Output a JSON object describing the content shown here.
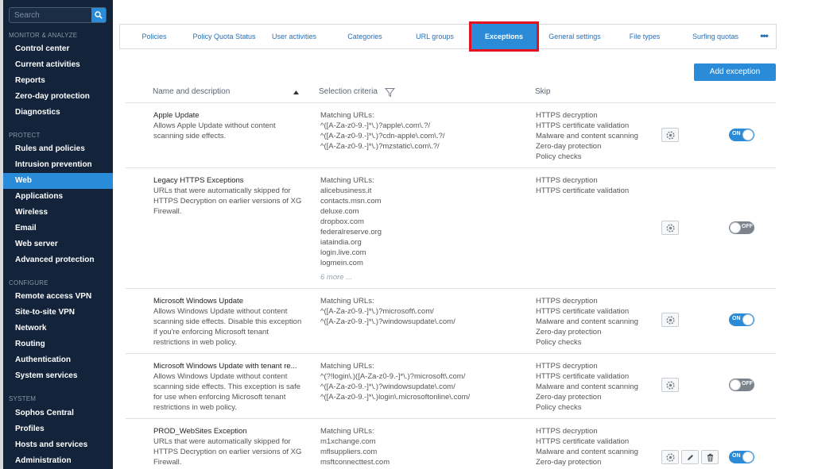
{
  "sidebar": {
    "search_placeholder": "Search",
    "sections": [
      {
        "label": "MONITOR & ANALYZE",
        "items": [
          "Control center",
          "Current activities",
          "Reports",
          "Zero-day protection",
          "Diagnostics"
        ]
      },
      {
        "label": "PROTECT",
        "items": [
          "Rules and policies",
          "Intrusion prevention",
          "Web",
          "Applications",
          "Wireless",
          "Email",
          "Web server",
          "Advanced protection"
        ]
      },
      {
        "label": "CONFIGURE",
        "items": [
          "Remote access VPN",
          "Site-to-site VPN",
          "Network",
          "Routing",
          "Authentication",
          "System services"
        ]
      },
      {
        "label": "SYSTEM",
        "items": [
          "Sophos Central",
          "Profiles",
          "Hosts and services",
          "Administration"
        ]
      }
    ],
    "active_item": "Web"
  },
  "tabs": [
    "Policies",
    "Policy Quota Status",
    "User activities",
    "Categories",
    "URL groups",
    "Exceptions",
    "General settings",
    "File types",
    "Surfing quotas"
  ],
  "active_tab": "Exceptions",
  "more_tabs": "•••",
  "add_button": "Add exception",
  "table": {
    "headers": {
      "name": "Name and description",
      "criteria": "Selection criteria",
      "skip": "Skip"
    },
    "rows": [
      {
        "name": "Apple Update",
        "description": "Allows Apple Update without content scanning side effects.",
        "criteria_label": "Matching URLs:",
        "criteria": [
          "^([A-Za-z0-9.-]*\\.)?apple\\.com\\.?/",
          "^([A-Za-z0-9.-]*\\.)?cdn-apple\\.com\\.?/",
          "^([A-Za-z0-9.-]*\\.)?mzstatic\\.com\\.?/"
        ],
        "more": "",
        "skip": [
          "HTTPS decryption",
          "HTTPS certificate validation",
          "Malware and content scanning",
          "Zero-day protection",
          "Policy checks"
        ],
        "enabled": "ON"
      },
      {
        "name": "Legacy HTTPS Exceptions",
        "description": "URLs that were automatically skipped for HTTPS Decryption on earlier versions of XG Firewall.",
        "criteria_label": "Matching URLs:",
        "criteria": [
          "alicebusiness.it",
          "contacts.msn.com",
          "deluxe.com",
          "dropbox.com",
          "federalreserve.org",
          "iataindia.org",
          "login.live.com",
          "logmein.com"
        ],
        "more": "6 more ...",
        "skip": [
          "HTTPS decryption",
          "HTTPS certificate validation"
        ],
        "enabled": "OFF"
      },
      {
        "name": "Microsoft Windows Update",
        "description": "Allows Windows Update without content scanning side effects. Disable this exception if you're enforcing Microsoft tenant restrictions in web policy.",
        "criteria_label": "Matching URLs:",
        "criteria": [
          "^([A-Za-z0-9.-]*\\.)?microsoft\\.com/",
          "^([A-Za-z0-9.-]*\\.)?windowsupdate\\.com/"
        ],
        "more": "",
        "skip": [
          "HTTPS decryption",
          "HTTPS certificate validation",
          "Malware and content scanning",
          "Zero-day protection",
          "Policy checks"
        ],
        "enabled": "ON"
      },
      {
        "name": "Microsoft Windows Update with tenant re...",
        "description": "Allows Windows Update without content scanning side effects. This exception is safe for use when enforcing Microsoft tenant restrictions in web policy.",
        "criteria_label": "Matching URLs:",
        "criteria": [
          "^(?!login\\.)([A-Za-z0-9.-]*\\.)?microsoft\\.com/",
          "^([A-Za-z0-9.-]*\\.)?windowsupdate\\.com/",
          "^([A-Za-z0-9.-]*\\.)login\\.microsoftonline\\.com/"
        ],
        "more": "",
        "skip": [
          "HTTPS decryption",
          "HTTPS certificate validation",
          "Malware and content scanning",
          "Zero-day protection",
          "Policy checks"
        ],
        "enabled": "OFF"
      },
      {
        "name": "PROD_WebSites Exception",
        "description": "URLs that were automatically skipped for HTTPS Decryption on earlier versions of XG Firewall.",
        "criteria_label": "Matching URLs:",
        "criteria": [
          "m1xchange.com",
          "mflsuppliers.com",
          "msftconnecttest.com"
        ],
        "more": "",
        "skip": [
          "HTTPS decryption",
          "HTTPS certificate validation",
          "Malware and content scanning",
          "Zero-day protection"
        ],
        "enabled": "ON"
      }
    ]
  },
  "colors": {
    "sidebar": "#12233a",
    "accent": "#2a8bd8",
    "highlight": "#e8101a",
    "toggle_off": "#7b838c"
  }
}
